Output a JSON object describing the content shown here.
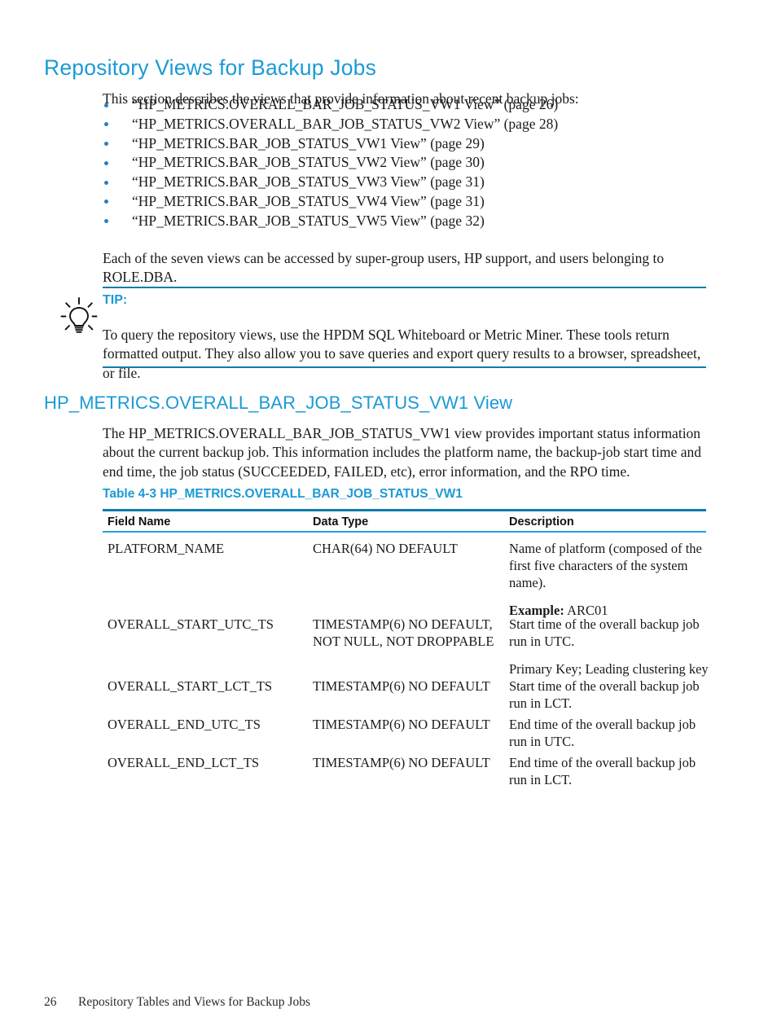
{
  "page": {
    "heading": "Repository Views for Backup Jobs",
    "intro": "This section describes the views that provide information about recent backup jobs:",
    "bullets": [
      "“HP_METRICS.OVERALL_BAR_JOB_STATUS_VW1 View” (page 26)",
      "“HP_METRICS.OVERALL_BAR_JOB_STATUS_VW2 View” (page 28)",
      "“HP_METRICS.BAR_JOB_STATUS_VW1 View” (page 29)",
      "“HP_METRICS.BAR_JOB_STATUS_VW2 View” (page 30)",
      "“HP_METRICS.BAR_JOB_STATUS_VW3 View” (page 31)",
      "“HP_METRICS.BAR_JOB_STATUS_VW4 View” (page 31)",
      "“HP_METRICS.BAR_JOB_STATUS_VW5 View” (page 32)"
    ],
    "paragraph_after_bullets": "Each of the seven views can be accessed by super-group users, HP support, and users belonging to ROLE.DBA."
  },
  "tip": {
    "label": "TIP:",
    "body": "To query the repository views, use the HPDM SQL Whiteboard or Metric Miner. These tools return formatted output. They also allow you to save queries and export query results to a browser, spreadsheet, or file.",
    "icon": "lightbulb-icon",
    "rule_color": "#0e7bae",
    "label_color": "#1b9ad6"
  },
  "section": {
    "heading": "HP_METRICS.OVERALL_BAR_JOB_STATUS_VW1 View",
    "paragraph": "The HP_METRICS.OVERALL_BAR_JOB_STATUS_VW1 view provides important status information about the current backup job. This information includes the platform name, the backup-job start time and end time, the job status (SUCCEEDED, FAILED, etc), error information, and the RPO time."
  },
  "table": {
    "caption": "Table 4-3 HP_METRICS.OVERALL_BAR_JOB_STATUS_VW1",
    "columns": [
      "Field Name",
      "Data Type",
      "Description"
    ],
    "rows": [
      {
        "field_name": "PLATFORM_NAME",
        "data_type": "CHAR(64) NO DEFAULT",
        "description": "Name of platform (composed of the first five characters of the system name).",
        "sub_label": "Example:",
        "sub_value": "ARC01"
      },
      {
        "field_name": "OVERALL_START_UTC_TS",
        "data_type": "TIMESTAMP(6) NO DEFAULT, NOT NULL, NOT DROPPABLE",
        "description": "Start time of the overall backup job run in UTC.",
        "sub_label": "",
        "sub_value": "Primary Key; Leading clustering key"
      },
      {
        "field_name": "OVERALL_START_LCT_TS",
        "data_type": "TIMESTAMP(6) NO DEFAULT",
        "description": "Start time of the overall backup job run in LCT.",
        "sub_label": "",
        "sub_value": ""
      },
      {
        "field_name": "OVERALL_END_UTC_TS",
        "data_type": "TIMESTAMP(6) NO DEFAULT",
        "description": "End time of the overall backup job run in UTC.",
        "sub_label": "",
        "sub_value": ""
      },
      {
        "field_name": "OVERALL_END_LCT_TS",
        "data_type": "TIMESTAMP(6) NO DEFAULT",
        "description": "End time of the overall backup job run in LCT.",
        "sub_label": "",
        "sub_value": ""
      }
    ]
  },
  "footer": {
    "page_number": "26",
    "chapter_title": "Repository Tables and Views for Backup Jobs"
  },
  "colors": {
    "accent_blue": "#1b9ad6",
    "rule_blue": "#0e7bae",
    "bullet_blue": "#2a7fc0",
    "text": "#1a1a1a"
  }
}
